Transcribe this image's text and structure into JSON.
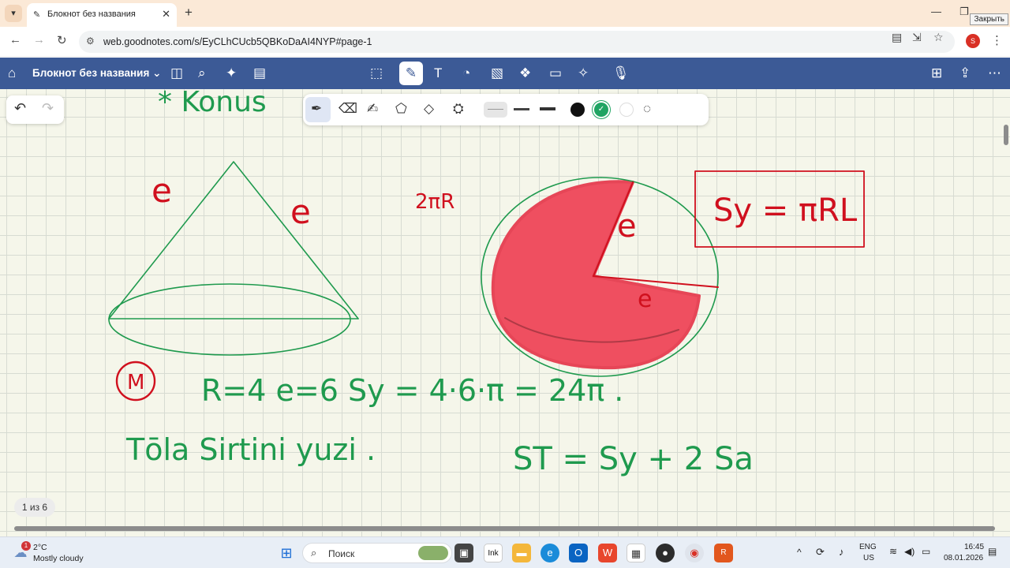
{
  "browser": {
    "tab_title": "Блокнот без названия",
    "url": "web.goodnotes.com/s/EyCLhCUcb5QBKoDaAI4NYP#page-1",
    "close_tooltip": "Закрыть",
    "profile_initial": "S"
  },
  "app": {
    "notebook_title": "Блокнот без названия",
    "page_indicator": "1 из 6"
  },
  "pen_toolbar": {
    "tools": [
      "pen",
      "eraser",
      "highlighter",
      "shape",
      "lasso",
      "elements"
    ],
    "colors": [
      "#111111",
      "#1fa463",
      "#ffffff"
    ],
    "selected_color": "#1fa463"
  },
  "handwriting": {
    "heading": "* Konus",
    "cone_label_l1": "e",
    "cone_label_l2": "e",
    "arc_label": "2πR",
    "sector_label_l1": "e",
    "sector_label_l2": "e",
    "formula_box": "Sy = πRL",
    "example_marker": "M",
    "example_line": "R=4  e=6  Sy = 4·6·π = 24π .",
    "bottom_text": "Tōla Sirtini  yuzi .",
    "bottom_formula": "ST = Sy + 2 Sa"
  },
  "taskbar": {
    "weather_temp": "2°C",
    "weather_desc": "Mostly cloudy",
    "weather_badge": "1",
    "search_placeholder": "Поиск",
    "lang_top": "ENG",
    "lang_bottom": "US",
    "time": "16:45",
    "date": "08.01.2026"
  },
  "colors": {
    "header_bg": "#3c5a96",
    "ink_green": "#1f9a4e",
    "ink_red": "#d0101e",
    "highlight_red": "#ef4f60"
  }
}
